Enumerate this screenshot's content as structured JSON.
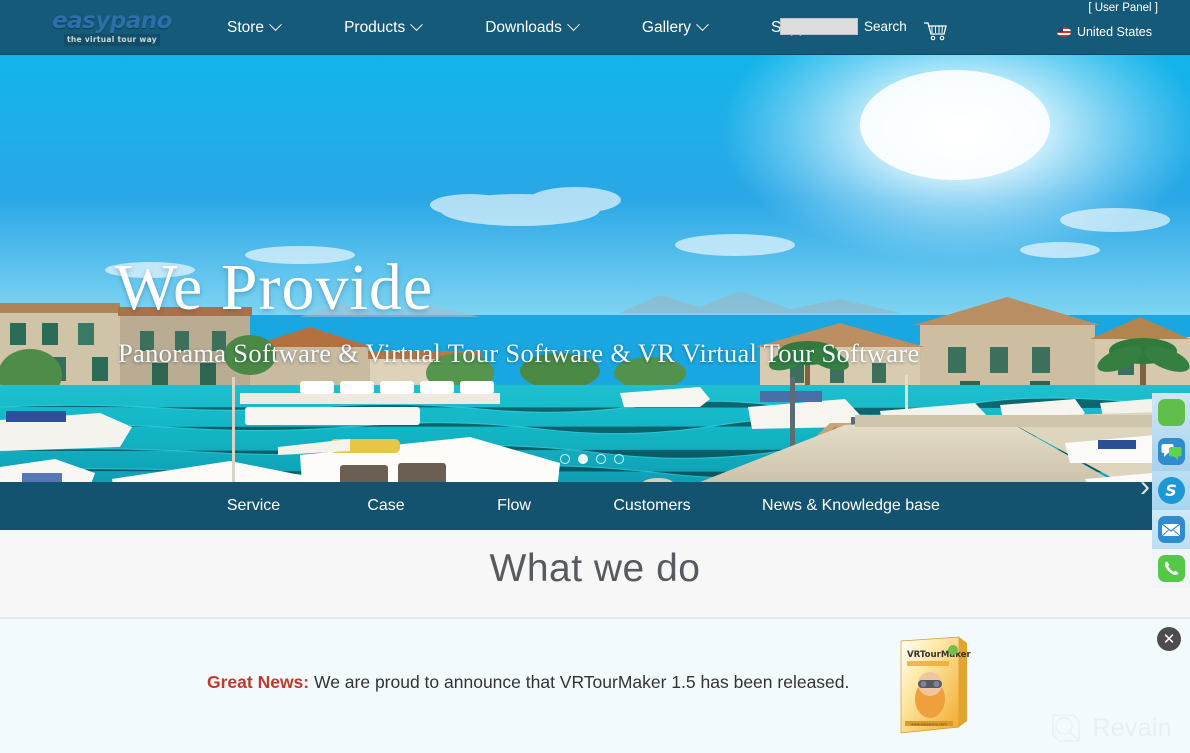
{
  "header": {
    "logo": {
      "word": "easypano",
      "tagline": "the virtual tour way"
    },
    "nav": [
      {
        "label": "Store",
        "icon": "chevron-down-icon"
      },
      {
        "label": "Products",
        "icon": "chevron-down-icon"
      },
      {
        "label": "Downloads",
        "icon": "chevron-down-icon"
      },
      {
        "label": "Gallery",
        "icon": "chevron-down-icon"
      },
      {
        "label": "Support",
        "icon": "chevron-down-icon"
      }
    ],
    "search": {
      "value": "",
      "placeholder": "",
      "label": "Search"
    },
    "cart_icon": "shopping-cart-icon",
    "user_panel": "[ User Panel ]",
    "country": {
      "label": "United States",
      "icon": "us-flag-icon"
    },
    "background_color": "#155a78"
  },
  "hero": {
    "title": "We Provide",
    "subtitle": "Panorama Software & Virtual Tour Software & VR Virtual Tour Software",
    "carousel": {
      "total": 4,
      "active_index": 1
    },
    "next_arrow": "chevron-right-icon"
  },
  "subnav": {
    "items": [
      {
        "label": "Service"
      },
      {
        "label": "Case"
      },
      {
        "label": "Flow"
      },
      {
        "label": "Customers"
      },
      {
        "label": "News & Knowledge base"
      }
    ],
    "background_color": "#13536f"
  },
  "section": {
    "heading": "What we do"
  },
  "banner": {
    "highlight": "Great News:",
    "message": " We are proud to announce that VRTourMaker 1.5 has been released.",
    "highlight_color": "#c0392b",
    "product_box": {
      "title": "VRTourMaker",
      "subtitle": "Make Virtual Tour Anywhere",
      "url": "www.easypano.com"
    },
    "close_icon": "close-icon",
    "background_color": "#f3fafd"
  },
  "watermark": {
    "text": "Revain",
    "icon": "revain-logo-icon"
  },
  "floating_toolbar": {
    "items": [
      {
        "name": "qq-top-icon",
        "label": ""
      },
      {
        "name": "chat-bubbles-icon",
        "label": ""
      },
      {
        "name": "skype-icon",
        "label": "S"
      },
      {
        "name": "email-icon",
        "label": ""
      },
      {
        "name": "phone-icon",
        "label": ""
      }
    ]
  }
}
